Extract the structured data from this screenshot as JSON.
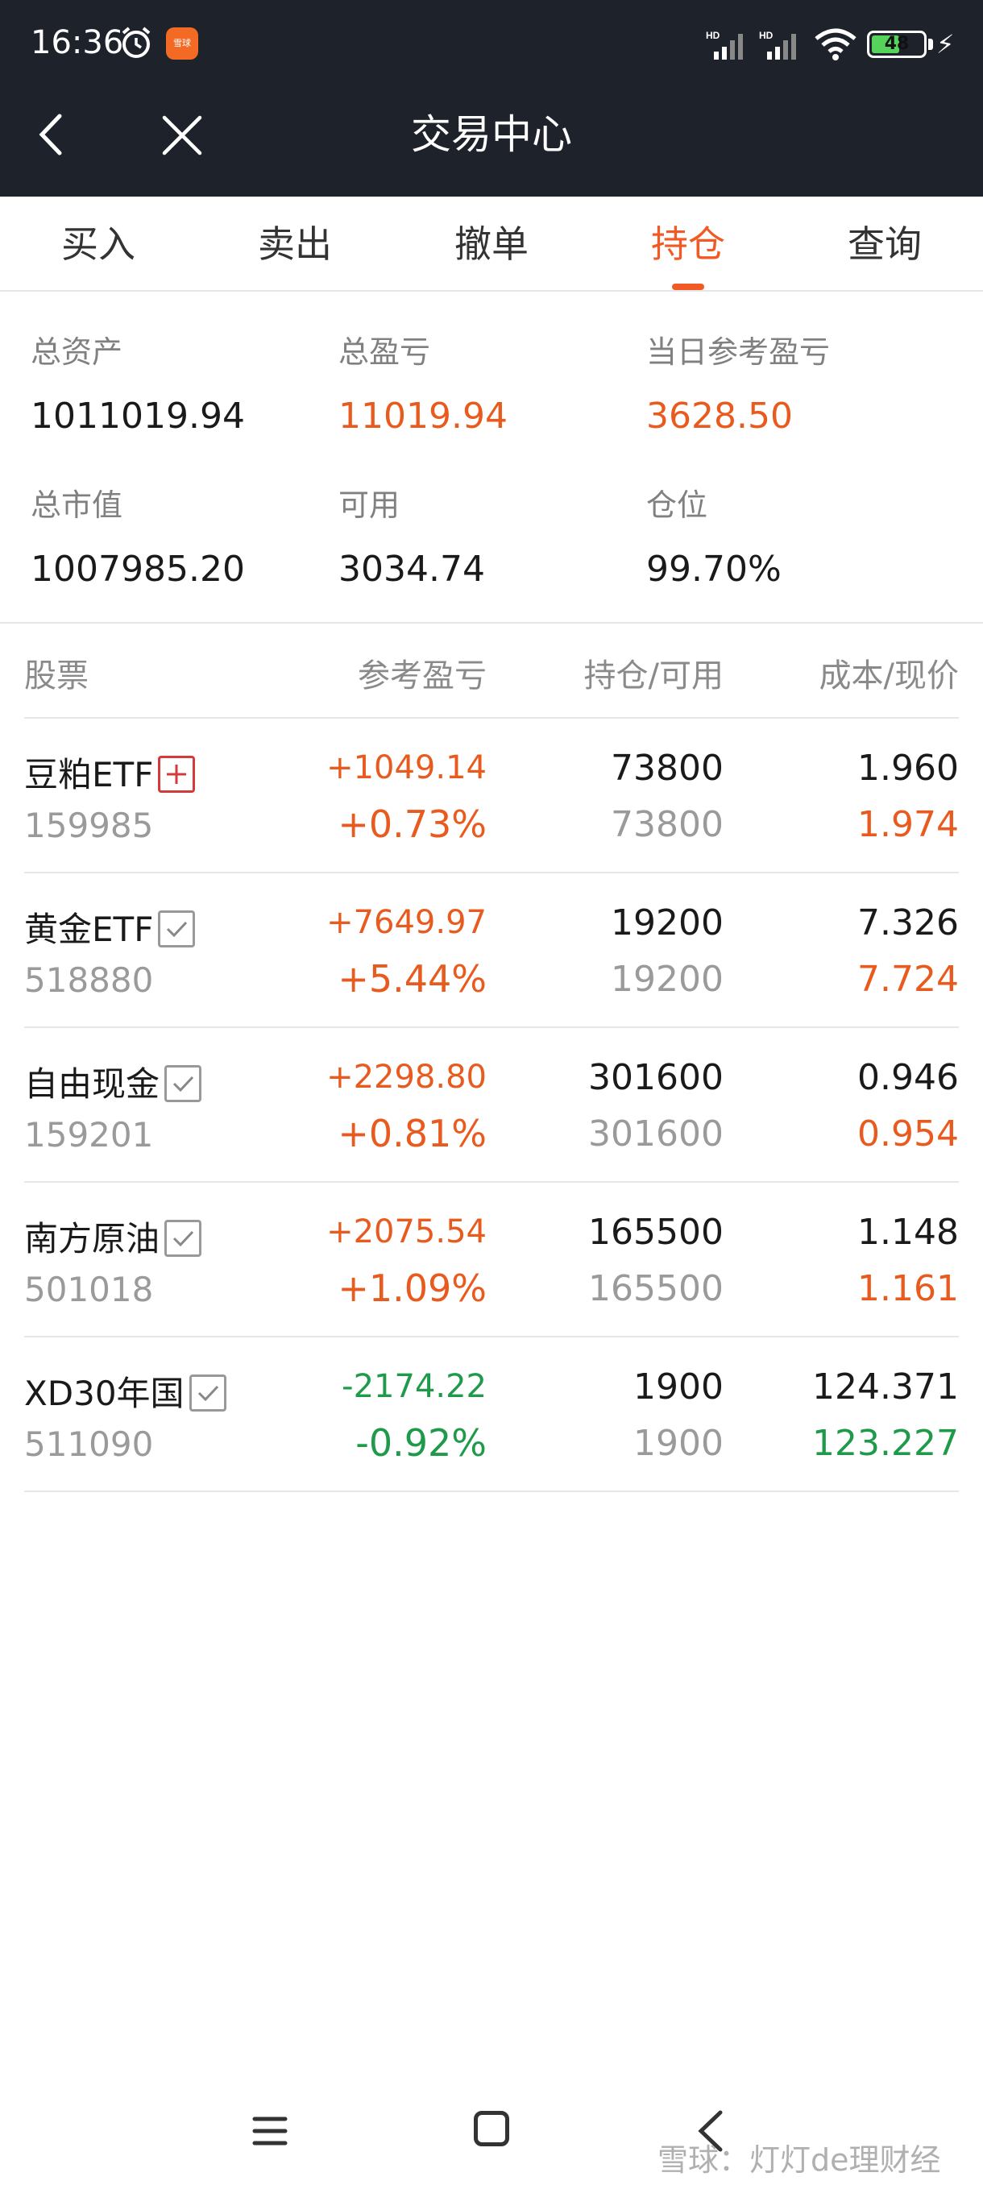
{
  "status": {
    "time": "16:36",
    "battery": "48",
    "app_badge": "雪球"
  },
  "header": {
    "title": "交易中心"
  },
  "tabs": [
    {
      "label": "买入",
      "active": false
    },
    {
      "label": "卖出",
      "active": false
    },
    {
      "label": "撤单",
      "active": false
    },
    {
      "label": "持仓",
      "active": true
    },
    {
      "label": "查询",
      "active": false
    }
  ],
  "summary": {
    "total_assets_label": "总资产",
    "total_assets": "1011019.94",
    "total_pl_label": "总盈亏",
    "total_pl": "11019.94",
    "today_pl_label": "当日参考盈亏",
    "today_pl": "3628.50",
    "market_value_label": "总市值",
    "market_value": "1007985.20",
    "available_label": "可用",
    "available": "3034.74",
    "position_label": "仓位",
    "position": "99.70%"
  },
  "table": {
    "headers": {
      "stock": "股票",
      "pl": "参考盈亏",
      "holding": "持仓/可用",
      "cost": "成本/现价"
    },
    "rows": [
      {
        "name": "豆粕ETF",
        "tag": "plus",
        "code": "159985",
        "pl_amount": "+1049.14",
        "pl_percent": "+0.73%",
        "holding": "73800",
        "available": "73800",
        "cost": "1.960",
        "price": "1.974",
        "direction": "up"
      },
      {
        "name": "黄金ETF",
        "tag": "check",
        "code": "518880",
        "pl_amount": "+7649.97",
        "pl_percent": "+5.44%",
        "holding": "19200",
        "available": "19200",
        "cost": "7.326",
        "price": "7.724",
        "direction": "up"
      },
      {
        "name": "自由现金",
        "tag": "check",
        "code": "159201",
        "pl_amount": "+2298.80",
        "pl_percent": "+0.81%",
        "holding": "301600",
        "available": "301600",
        "cost": "0.946",
        "price": "0.954",
        "direction": "up"
      },
      {
        "name": "南方原油",
        "tag": "check",
        "code": "501018",
        "pl_amount": "+2075.54",
        "pl_percent": "+1.09%",
        "holding": "165500",
        "available": "165500",
        "cost": "1.148",
        "price": "1.161",
        "direction": "up"
      },
      {
        "name": "XD30年国",
        "tag": "check",
        "code": "511090",
        "pl_amount": "-2174.22",
        "pl_percent": "-0.92%",
        "holding": "1900",
        "available": "1900",
        "cost": "124.371",
        "price": "123.227",
        "direction": "down"
      }
    ]
  },
  "watermark": "雪球：灯灯de理财经",
  "colors": {
    "accent": "#f15a24",
    "up": "#e85a1e",
    "down": "#1e9a4a",
    "header_bg": "#1e232b"
  },
  "icons": [
    "alarm-icon",
    "signal-icon",
    "wifi-icon",
    "battery-icon",
    "bolt-icon",
    "back-icon",
    "close-icon",
    "plus-icon",
    "check-icon",
    "menu-icon",
    "home-icon",
    "nav-back-icon"
  ]
}
